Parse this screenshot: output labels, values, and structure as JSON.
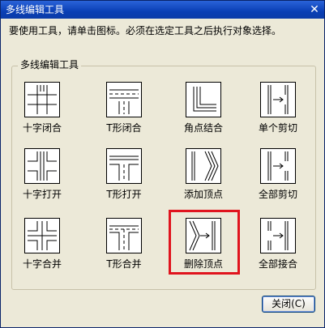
{
  "window": {
    "title": "多线编辑工具",
    "close_glyph": "✕"
  },
  "instruction": "要使用工具，请单击图标。必须在选定工具之后执行对象选择。",
  "group": {
    "label": "多线编辑工具",
    "tools": [
      {
        "label": "十字闭合",
        "icon": "cross-closed-icon"
      },
      {
        "label": "T形闭合",
        "icon": "t-closed-icon"
      },
      {
        "label": "角点结合",
        "icon": "corner-joint-icon"
      },
      {
        "label": "单个剪切",
        "icon": "cut-single-icon"
      },
      {
        "label": "十字打开",
        "icon": "cross-open-icon"
      },
      {
        "label": "T形打开",
        "icon": "t-open-icon"
      },
      {
        "label": "添加顶点",
        "icon": "add-vertex-icon"
      },
      {
        "label": "全部剪切",
        "icon": "cut-all-icon"
      },
      {
        "label": "十字合并",
        "icon": "cross-merged-icon"
      },
      {
        "label": "T形合并",
        "icon": "t-merged-icon"
      },
      {
        "label": "删除顶点",
        "icon": "delete-vertex-icon"
      },
      {
        "label": "全部接合",
        "icon": "weld-all-icon"
      }
    ]
  },
  "buttons": {
    "close_label": "关闭(C)"
  },
  "colors": {
    "title_bar": "#0a3fb5",
    "highlight": "#e0141e",
    "dialog_bg": "#ece9d8"
  }
}
